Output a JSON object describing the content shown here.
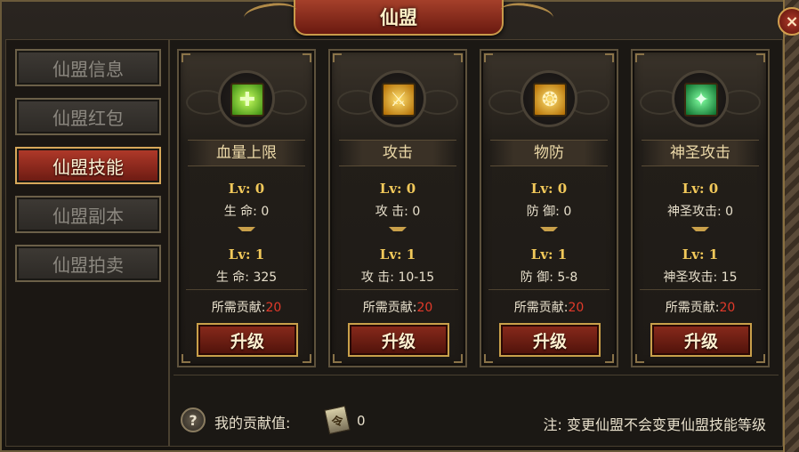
{
  "window": {
    "title": "仙盟"
  },
  "menu": {
    "items": [
      {
        "label": "仙盟信息",
        "active": false
      },
      {
        "label": "仙盟红包",
        "active": false
      },
      {
        "label": "仙盟技能",
        "active": true
      },
      {
        "label": "仙盟副本",
        "active": false
      },
      {
        "label": "仙盟拍卖",
        "active": false
      }
    ]
  },
  "skills": [
    {
      "name": "血量上限",
      "icon": "blood-cap-icon",
      "cur_lv": "Lv: 0",
      "cur_stat": "生    命: 0",
      "next_lv": "Lv: 1",
      "next_stat": "生    命: 325",
      "cost_label": "所需贡献:",
      "cost_value": "20",
      "button": "升级"
    },
    {
      "name": "攻击",
      "icon": "attack-icon",
      "cur_lv": "Lv: 0",
      "cur_stat": "攻    击: 0",
      "next_lv": "Lv: 1",
      "next_stat": "攻    击: 10-15",
      "cost_label": "所需贡献:",
      "cost_value": "20",
      "button": "升级"
    },
    {
      "name": "物防",
      "icon": "defense-icon",
      "cur_lv": "Lv: 0",
      "cur_stat": "防    御: 0",
      "next_lv": "Lv: 1",
      "next_stat": "防    御: 5-8",
      "cost_label": "所需贡献:",
      "cost_value": "20",
      "button": "升级"
    },
    {
      "name": "神圣攻击",
      "icon": "holy-attack-icon",
      "cur_lv": "Lv: 0",
      "cur_stat": "神圣攻击: 0",
      "next_lv": "Lv: 1",
      "next_stat": "神圣攻击: 15",
      "cost_label": "所需贡献:",
      "cost_value": "20",
      "button": "升级"
    }
  ],
  "footer": {
    "help_icon": "?",
    "contrib_label": "我的贡献值:",
    "contrib_value": "0",
    "note": "注: 变更仙盟不会变更仙盟技能等级"
  },
  "colors": {
    "accent": "#c9a04a",
    "active_tab": "#b23a2a",
    "cost_red": "#e23a2a",
    "level_gold": "#f2c95a"
  }
}
